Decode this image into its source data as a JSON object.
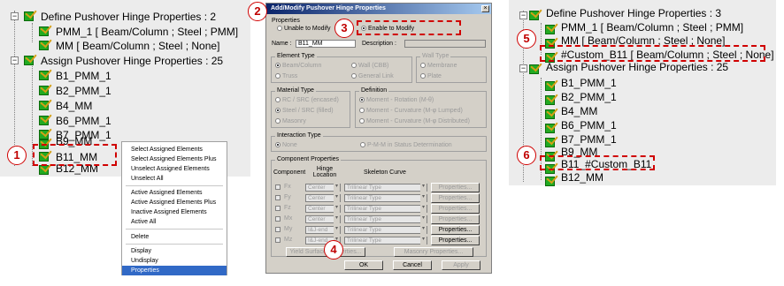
{
  "left_panel": {
    "tree": [
      {
        "label": "Define Pushover Hinge Properties : 2"
      },
      {
        "label": "PMM_1 [ Beam/Column ; Steel ; PMM]"
      },
      {
        "label": "MM [ Beam/Column ; Steel ; None]"
      },
      {
        "label": "Assign Pushover Hinge Properties : 25"
      },
      {
        "label": "B1_PMM_1"
      },
      {
        "label": "B2_PMM_1"
      },
      {
        "label": "B4_MM"
      },
      {
        "label": "B6_PMM_1"
      },
      {
        "label": "B7_PMM_1"
      },
      {
        "label": "B9_MM"
      },
      {
        "label": "B11_MM"
      },
      {
        "label": "B12_MM"
      }
    ],
    "expander_minus": "−",
    "badge": "1"
  },
  "context_menu": {
    "items": [
      "Select Assigned Elements",
      "Select Assigned Elements Plus",
      "Unselect Assigned Elements",
      "Unselect All",
      "Active Assigned Elements",
      "Active Assigned Elements Plus",
      "Inactive Assigned Elements",
      "Active All",
      "Delete",
      "Display",
      "Undisplay",
      "Properties"
    ],
    "selected": "Properties",
    "highlight_color": "#3169c6"
  },
  "dialog": {
    "title": "Add/Modify Pushover Hinge Properties",
    "close_glyph": "×",
    "properties_group": "Properties",
    "unable_label": "Unable to Modify",
    "enable_label": "Enable to Modify",
    "name_label": "Name :",
    "name_value": "B11_MM",
    "description_label": "Description :",
    "element_type": {
      "title": "Element Type",
      "options": [
        "Beam/Column",
        "Wall (CBB)",
        "Truss",
        "General Link"
      ]
    },
    "wall_type": {
      "title": "Wall Type",
      "options": [
        "Membrane",
        "Plate"
      ]
    },
    "material_type": {
      "title": "Material Type",
      "options": [
        "RC / SRC (encased)",
        "Steel / SRC (filled)",
        "Masonry"
      ]
    },
    "definition": {
      "title": "Definition",
      "options": [
        "Moment - Rotation (M-θ)",
        "Moment - Curvature (M-φ Lumped)",
        "Moment - Curvature (M-φ Distributed)"
      ]
    },
    "interaction_type": {
      "title": "Interaction Type",
      "options": [
        "None",
        "P-M-M in Status Determination"
      ]
    },
    "component_properties": {
      "title": "Component Properties",
      "col_component": "Component",
      "col_hinge": "Hinge Location",
      "col_skeleton": "Skeleton Curve",
      "rows": [
        {
          "name": "Fx",
          "location": "Center",
          "curve": "Trilinear Type",
          "button": "Properties..."
        },
        {
          "name": "Fy",
          "location": "Center",
          "curve": "Trilinear Type",
          "button": "Properties..."
        },
        {
          "name": "Fz",
          "location": "Center",
          "curve": "Trilinear Type",
          "button": "Properties..."
        },
        {
          "name": "Mx",
          "location": "Center",
          "curve": "Trilinear Type",
          "button": "Properties..."
        },
        {
          "name": "My",
          "location": "I&J-end",
          "curve": "Trilinear Type",
          "button": "Properties..."
        },
        {
          "name": "Mz",
          "location": "I&J-end",
          "curve": "Trilinear Type",
          "button": "Properties..."
        }
      ],
      "yield_button": "Yield Surface Properties...",
      "masonry_button": "Masonry Properties..."
    },
    "ok_label": "OK",
    "cancel_label": "Cancel",
    "apply_label": "Apply",
    "badges": [
      "2",
      "3",
      "4"
    ]
  },
  "right_panel": {
    "tree": [
      {
        "label": "Define Pushover Hinge Properties : 3"
      },
      {
        "label": "PMM_1 [ Beam/Column ; Steel ; PMM]"
      },
      {
        "label": "MM [ Beam/Column ; Steel ; None]"
      },
      {
        "label": "#Custom_B11 [ Beam/Column ; Steel ; None]"
      },
      {
        "label": "Assign Pushover Hinge Properties : 25"
      },
      {
        "label": "B1_PMM_1"
      },
      {
        "label": "B2_PMM_1"
      },
      {
        "label": "B4_MM"
      },
      {
        "label": "B6_PMM_1"
      },
      {
        "label": "B7_PMM_1"
      },
      {
        "label": "B9_MM"
      },
      {
        "label": "B11_#Custom_B11"
      },
      {
        "label": "B12_MM"
      }
    ],
    "badges": [
      "5",
      "6"
    ]
  },
  "annotation_color": "#d00000"
}
